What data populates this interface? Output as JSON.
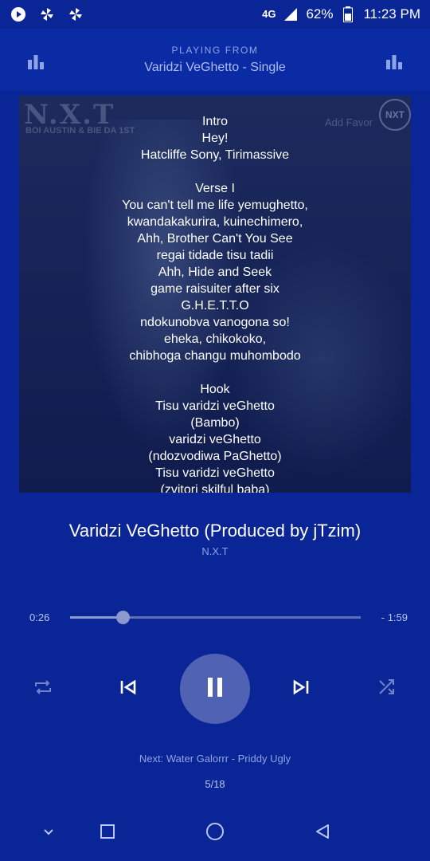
{
  "status_bar": {
    "network": "4G",
    "battery": "62%",
    "time": "11:23 PM"
  },
  "header": {
    "playing_from_label": "PLAYING FROM",
    "album": "Varidzi VeGhetto - Single"
  },
  "artwork": {
    "logo_text": "N.X.T",
    "logo_subtitle": "BOI AUSTIN & BIE DA 1ST",
    "watermark_text": "Add Favor",
    "seal_text": "NXT"
  },
  "lyrics": [
    "Intro",
    "Hey!",
    "Hatcliffe Sony, Tirimassive",
    "",
    "Verse I",
    "You can't tell me life yemughetto,",
    "kwandakakurira, kuinechimero,",
    "Ahh, Brother Can't You See",
    "regai tidade tisu tadii",
    "Ahh, Hide and Seek",
    "game raisuiter after six",
    "G.H.E.T.T.O",
    "ndokunobva vanogona so!",
    "eheka, chikokoko,",
    "chibhoga changu muhombodo",
    "",
    "Hook",
    "Tisu varidzi veGhetto",
    "(Bambo)",
    "varidzi veGhetto",
    "(ndozvodiwa PaGhetto)",
    "Tisu varidzi veGhetto",
    "(zvitori skilful baba)"
  ],
  "track": {
    "title": "Varidzi VeGhetto (Produced by jTzim)",
    "artist": "N.X.T"
  },
  "progress": {
    "elapsed": "0:26",
    "remaining": "- 1:59",
    "fraction": 0.18
  },
  "queue": {
    "next_label": "Next: Water Galorrr - Priddy Ugly",
    "position": "5/18"
  },
  "colors": {
    "background": "#0a2596",
    "header": "#0b2ba4",
    "play_button": "#4f62b4",
    "muted_text": "#8ea3e6"
  },
  "icons": {
    "status": [
      "play-store-icon",
      "pinwheel-icon",
      "pinwheel-icon",
      "signal-icon",
      "battery-icon"
    ],
    "header": [
      "equalizer-icon",
      "equalizer-icon"
    ],
    "controls": [
      "repeat-icon",
      "previous-icon",
      "pause-icon",
      "next-icon",
      "shuffle-icon"
    ],
    "nav": [
      "chevron-down-icon",
      "recent-apps-icon",
      "home-icon",
      "back-icon"
    ]
  }
}
